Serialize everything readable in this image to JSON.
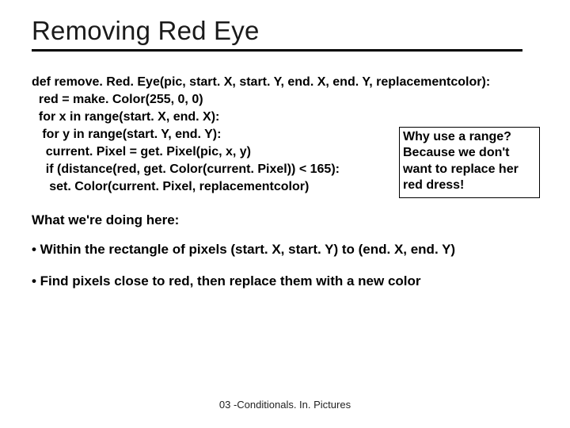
{
  "title": "Removing Red Eye",
  "code": {
    "l1": "def remove. Red. Eye(pic, start. X, start. Y, end. X, end. Y, replacementcolor):",
    "l2": "  red = make. Color(255, 0, 0)",
    "l3": "  for x in range(start. X, end. X):",
    "l4": "   for y in range(start. Y, end. Y):",
    "l5": "    current. Pixel = get. Pixel(pic, x, y)",
    "l6": "    if (distance(red, get. Color(current. Pixel)) < 165):",
    "l7": "     set. Color(current. Pixel, replacementcolor)"
  },
  "callout": {
    "line1": "Why use a range?",
    "line2": "Because we don't want to replace her red dress!"
  },
  "section_head": "What we're doing here:",
  "bullet1": "• Within the rectangle of pixels (start. X, start. Y) to (end. X, end. Y)",
  "bullet2": "• Find pixels close to red, then replace them with a new color",
  "footer": "03 -Conditionals. In. Pictures"
}
